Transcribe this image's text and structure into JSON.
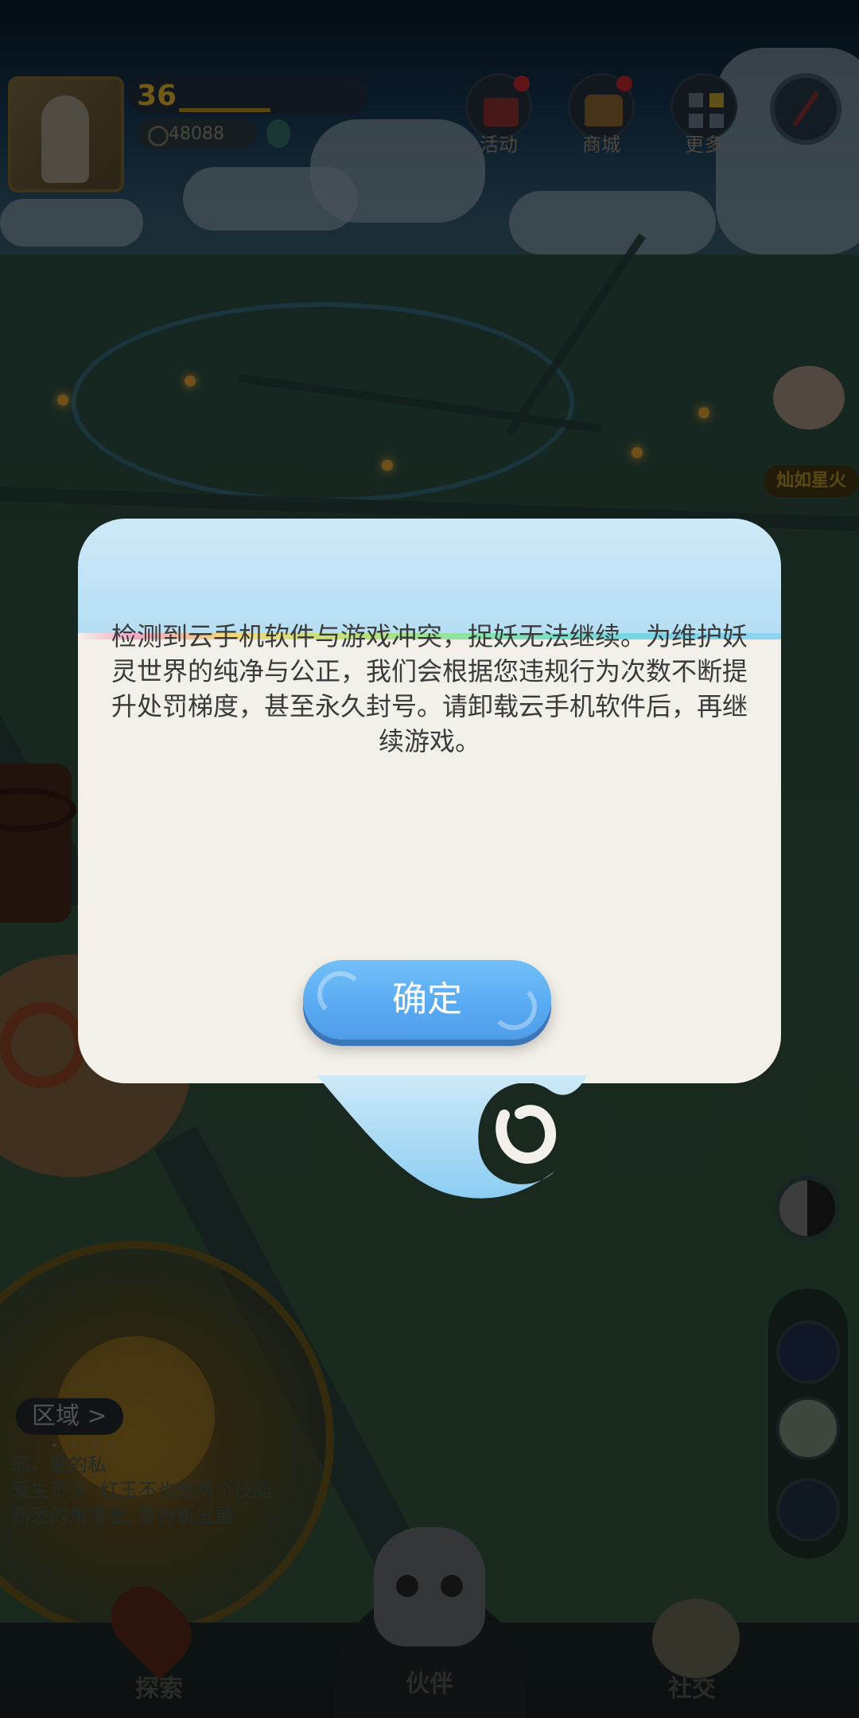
{
  "profile": {
    "level": "36",
    "coins": "48088"
  },
  "top_buttons": [
    {
      "label": "活动",
      "icon": "gift-icon",
      "badge": true
    },
    {
      "label": "商城",
      "icon": "shop-icon",
      "badge": true
    },
    {
      "label": "更多",
      "icon": "more-icon",
      "badge": false
    }
  ],
  "mascot": {
    "label": "灿如星火"
  },
  "area": {
    "button_label": "区域 >",
    "feed": [
      "邪，要的私",
      "爱生不灭: 红玉不也是两个技能",
      "熟悉的角落里, 等待新五星"
    ]
  },
  "dialog": {
    "message": "检测到云手机软件与游戏冲突，捉妖无法继续。为维护妖灵世界的纯净与公正，我们会根据您违规行为次数不断提升处罚梯度，甚至永久封号。请卸载云手机软件后，再继续游戏。",
    "confirm_label": "确定"
  },
  "bottom_nav": [
    {
      "label": "探索",
      "icon": "location-pin-icon"
    },
    {
      "label": "伙伴",
      "icon": "ghost-companion-icon"
    },
    {
      "label": "社交",
      "icon": "social-icon"
    }
  ],
  "colors": {
    "dialog_header": "#b5def4",
    "dialog_body": "#f2f0e8",
    "confirm_button": "#58a9f2",
    "badge_red": "#a8232a"
  }
}
